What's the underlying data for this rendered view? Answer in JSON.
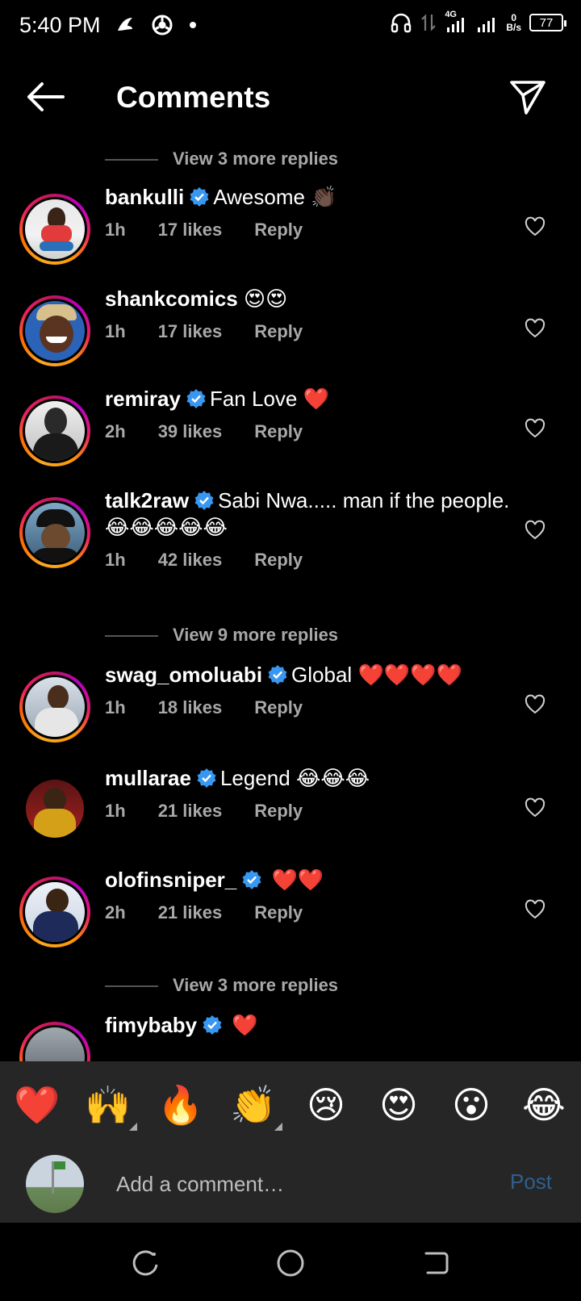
{
  "status_bar": {
    "time": "5:40 PM",
    "network_type": "4G",
    "speed_value": "0",
    "speed_unit": "B/s",
    "battery": "77"
  },
  "header": {
    "title": "Comments"
  },
  "view_more_1": "View 3 more replies",
  "view_more_2": "View 9 more replies",
  "view_more_3": "View 3 more replies",
  "comments": [
    {
      "username": "bankulli",
      "verified": true,
      "text": "Awesome",
      "emoji": "👏🏿",
      "time": "1h",
      "likes": "17 likes",
      "reply": "Reply"
    },
    {
      "username": "shankcomics",
      "verified": false,
      "text": "",
      "emoji": "😍😍",
      "time": "1h",
      "likes": "17 likes",
      "reply": "Reply"
    },
    {
      "username": "remiray",
      "verified": true,
      "text": "Fan Love",
      "emoji": "❤️",
      "time": "2h",
      "likes": "39 likes",
      "reply": "Reply"
    },
    {
      "username": "talk2raw",
      "verified": true,
      "text": "Sabi Nwa..... man if the people.",
      "emoji": "😂😂😂😂😂",
      "time": "1h",
      "likes": "42 likes",
      "reply": "Reply"
    },
    {
      "username": "swag_omoluabi",
      "verified": true,
      "text": "Global",
      "emoji": "❤️❤️❤️❤️",
      "time": "1h",
      "likes": "18 likes",
      "reply": "Reply"
    },
    {
      "username": "mullarae",
      "verified": true,
      "text": "Legend",
      "emoji": "😂😂😂",
      "time": "1h",
      "likes": "21 likes",
      "reply": "Reply"
    },
    {
      "username": "olofinsniper_",
      "verified": true,
      "text": "",
      "emoji": "❤️❤️",
      "time": "2h",
      "likes": "21 likes",
      "reply": "Reply"
    },
    {
      "username": "fimybaby",
      "verified": true,
      "text": "",
      "emoji": "❤️"
    }
  ],
  "emoji_tray": [
    "❤️",
    "🙌",
    "🔥",
    "👏",
    "😢",
    "😍",
    "😮",
    "😂"
  ],
  "composer": {
    "placeholder": "Add a comment…",
    "post_label": "Post"
  },
  "colors": {
    "background": "#000000",
    "secondary_text": "#a8a8a8",
    "verified_blue": "#3897f0",
    "tray_bg": "#262626",
    "post_disabled": "#2f5f8f"
  }
}
